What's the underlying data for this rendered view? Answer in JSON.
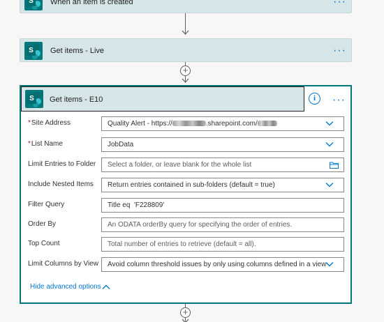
{
  "steps": [
    {
      "title": "When an item is created",
      "more": "···"
    },
    {
      "title": "Get items - Live",
      "more": "···"
    }
  ],
  "main": {
    "title": "Get items - E10",
    "info": "i",
    "more": "···",
    "fields": [
      {
        "label": "Site Address",
        "required": "*",
        "value": "Quality Alert - https://",
        "value_suffix": ".sharepoint.com/",
        "kind": "dropdown"
      },
      {
        "label": "List Name",
        "required": "*",
        "value": "JobData",
        "kind": "dropdown"
      },
      {
        "label": "Limit Entries to Folder",
        "required": "",
        "placeholder": "Select a folder, or leave blank for the whole list",
        "kind": "folder"
      },
      {
        "label": "Include Nested Items",
        "required": "",
        "value": "Return entries contained in sub-folders (default = true)",
        "kind": "dropdown"
      },
      {
        "label": "Filter Query",
        "required": "",
        "value": "Title eq  'F228809'",
        "kind": "text"
      },
      {
        "label": "Order By",
        "required": "",
        "placeholder": "An ODATA orderBy query for specifying the order of entries.",
        "kind": "text"
      },
      {
        "label": "Top Count",
        "required": "",
        "placeholder": "Total number of entries to retrieve (default = all).",
        "kind": "text"
      },
      {
        "label": "Limit Columns by View",
        "required": "",
        "value": "Avoid column threshold issues by only using columns defined in a view",
        "kind": "dropdown"
      }
    ],
    "advanced_link": "Hide advanced options"
  },
  "icons": {
    "connector": "sharepoint-icon",
    "add": "plus-icon"
  },
  "sp_letter": "S",
  "plus_glyph": "+",
  "colors": {
    "accent": "#0078d4",
    "sharepoint": "#03787c",
    "header_bg": "#d6e5e7",
    "required": "#a4262c"
  }
}
